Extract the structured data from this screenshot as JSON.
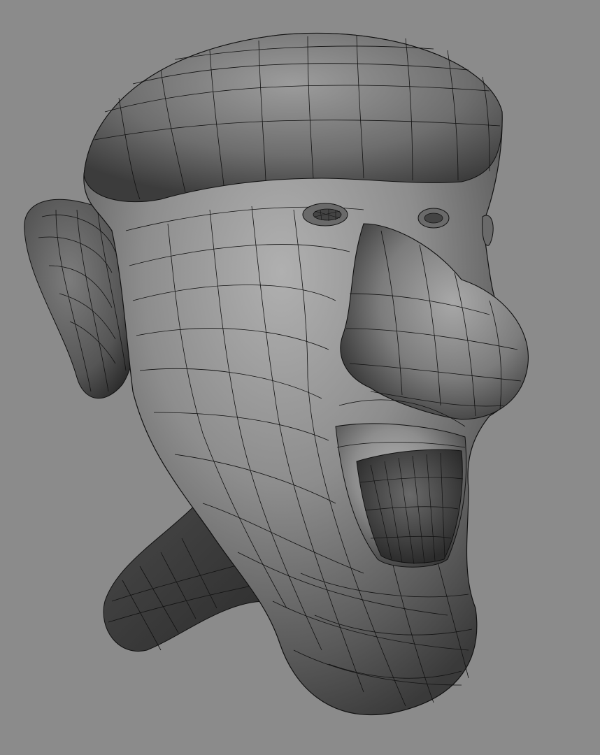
{
  "viewport": {
    "background_color": "#8b8b8b",
    "shading": "smooth-shaded-with-wireframe",
    "model": {
      "subject": "caricature-head",
      "base_color": "#7a7a7a",
      "highlight_color": "#b4b4b4",
      "shadow_color": "#2a2a2a",
      "wire_color": "#111111"
    }
  }
}
